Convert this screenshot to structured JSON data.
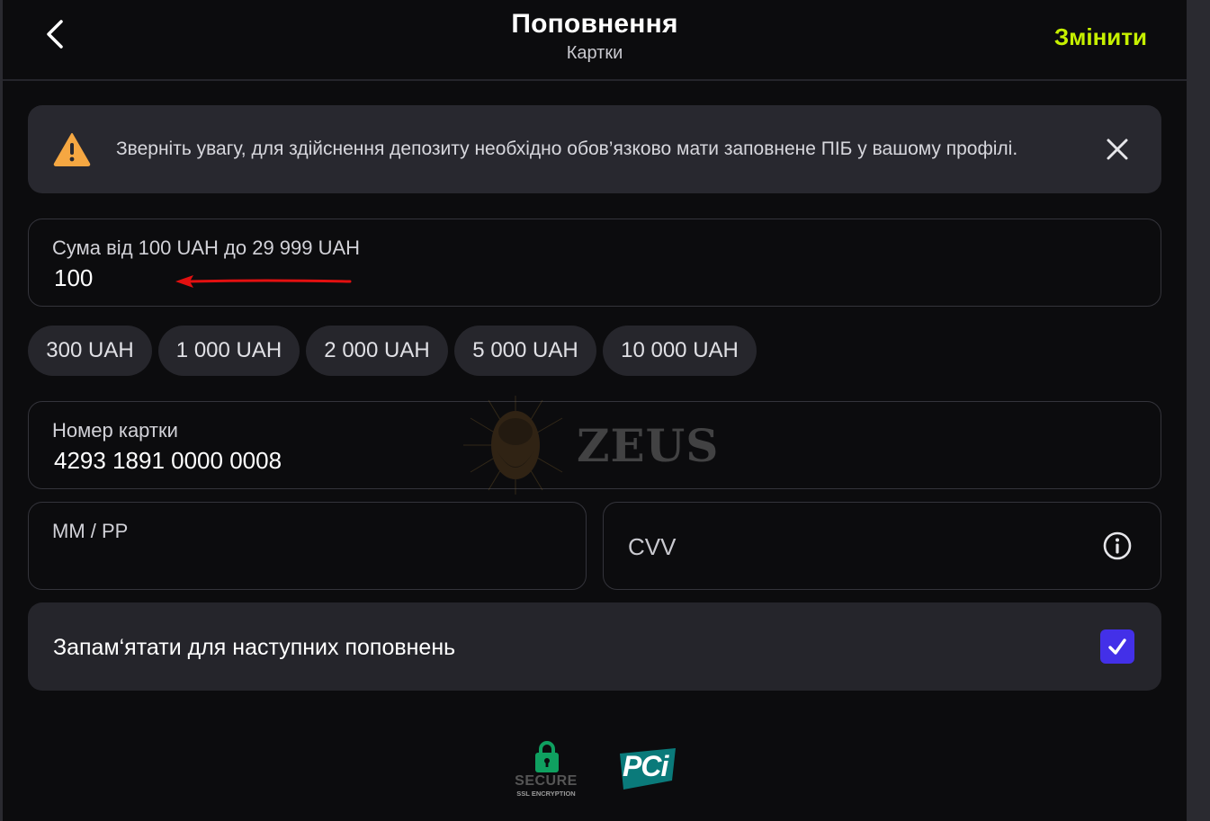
{
  "header": {
    "title": "Поповнення",
    "subtitle": "Картки",
    "change_label": "Змінити",
    "accent_color": "#c6f000"
  },
  "alert": {
    "text": "Зверніть увагу, для здійснення депозиту необхідно обов’язково мати заповнене ПІБ у вашому профілі.",
    "icon": "warning-icon",
    "icon_color": "#f5a742"
  },
  "amount": {
    "label": "Сума від 100 UAH до 29 999 UAH",
    "value": "100"
  },
  "quick_amounts": [
    "300 UAH",
    "1 000 UAH",
    "2 000 UAH",
    "5 000 UAH",
    "10 000 UAH"
  ],
  "card_number": {
    "label": "Номер картки",
    "value": "4293 1891 0000 0008"
  },
  "expiry": {
    "label": "ММ / РР",
    "value": ""
  },
  "cvv": {
    "placeholder": "CVV",
    "icon": "info-icon"
  },
  "remember": {
    "label": "Запам‘ятати для наступних поповнень",
    "checked": true,
    "checkbox_color": "#4330e8"
  },
  "watermark": {
    "text": "ZEUS"
  },
  "badges": {
    "secure_title": "SECURE",
    "secure_subtitle": "SSL ENCRYPTION",
    "pci_text": "PCi"
  }
}
